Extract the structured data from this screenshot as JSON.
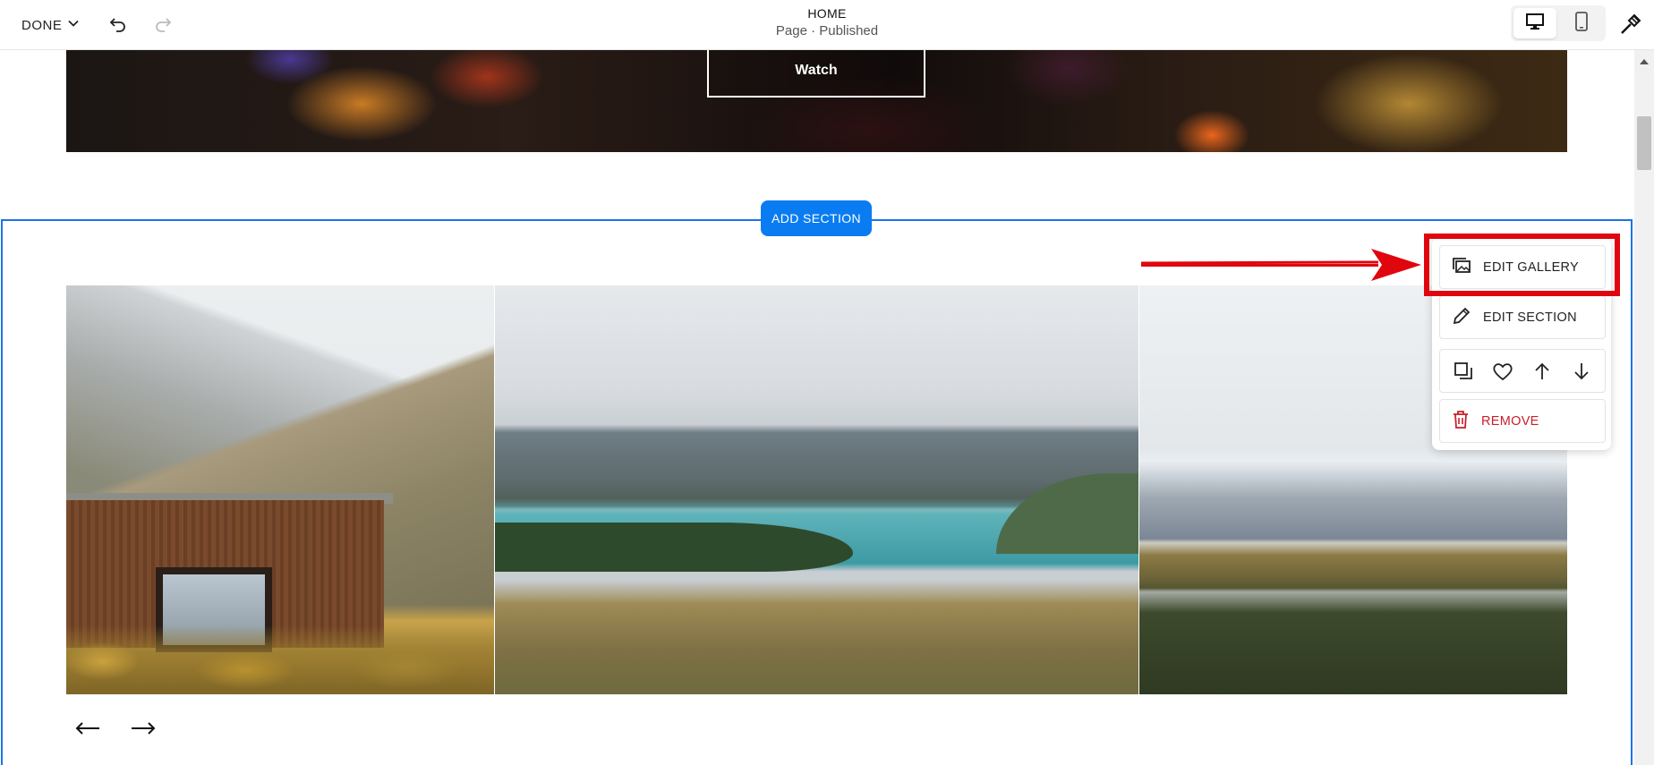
{
  "topbar": {
    "done_label": "DONE",
    "page_title": "HOME",
    "page_status": "Page · Published",
    "icons": [
      "undo-icon",
      "redo-icon",
      "desktop-icon",
      "mobile-icon",
      "design-brush-icon"
    ]
  },
  "hero": {
    "watch_label": "Watch"
  },
  "section": {
    "add_section_label": "ADD SECTION",
    "nav_prev": "←",
    "nav_next": "→"
  },
  "menu": {
    "edit_gallery_label": "EDIT GALLERY",
    "edit_section_label": "EDIT SECTION",
    "remove_label": "REMOVE",
    "row_icons": [
      "duplicate-icon",
      "favorite-heart-icon",
      "move-up-icon",
      "move-down-icon"
    ]
  },
  "colors": {
    "accent": "#0a7cf2",
    "selection_outline": "#1a73e8",
    "annotation_red": "#e0060e",
    "remove_red": "#c8202c"
  }
}
